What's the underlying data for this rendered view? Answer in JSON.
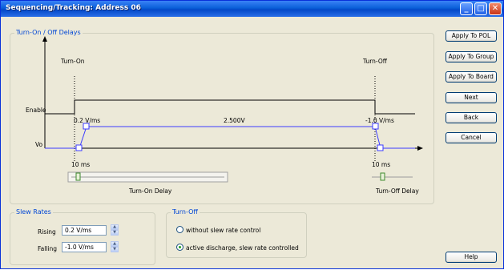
{
  "window": {
    "title": "Sequencing/Tracking: Address 06",
    "controls": {
      "minimize": "_",
      "maximize": "□",
      "close": "✕"
    }
  },
  "delays_group": {
    "legend": "Turn-On / Off Delays",
    "turn_on_label": "Turn-On",
    "turn_off_label": "Turn-Off",
    "enable_label": "Enable",
    "vo_label": "Vo",
    "rise_rate": "0.2 V/ms",
    "fall_rate": "-1.0 V/ms",
    "voltage": "2.500V",
    "turn_on_delay_value": "10 ms",
    "turn_off_delay_value": "10 ms",
    "turn_on_slider_caption": "Turn-On Delay",
    "turn_off_slider_caption": "Turn-Off Delay"
  },
  "slew_group": {
    "legend": "Slew Rates",
    "rising_label": "Rising",
    "rising_value": "0.2 V/ms",
    "falling_label": "Falling",
    "falling_value": "-1.0 V/ms"
  },
  "turnoff_group": {
    "legend": "Turn-Off",
    "option1": "without slew rate control",
    "option2": "active discharge, slew rate controlled",
    "selected": "option2"
  },
  "buttons": {
    "apply_pol": "Apply To POL",
    "apply_group": "Apply To Group",
    "apply_board": "Apply To Board",
    "next": "Next",
    "back": "Back",
    "cancel": "Cancel",
    "help": "Help"
  },
  "colors": {
    "trace_blue": "#3c3cff",
    "legend_blue": "#0046d5"
  }
}
